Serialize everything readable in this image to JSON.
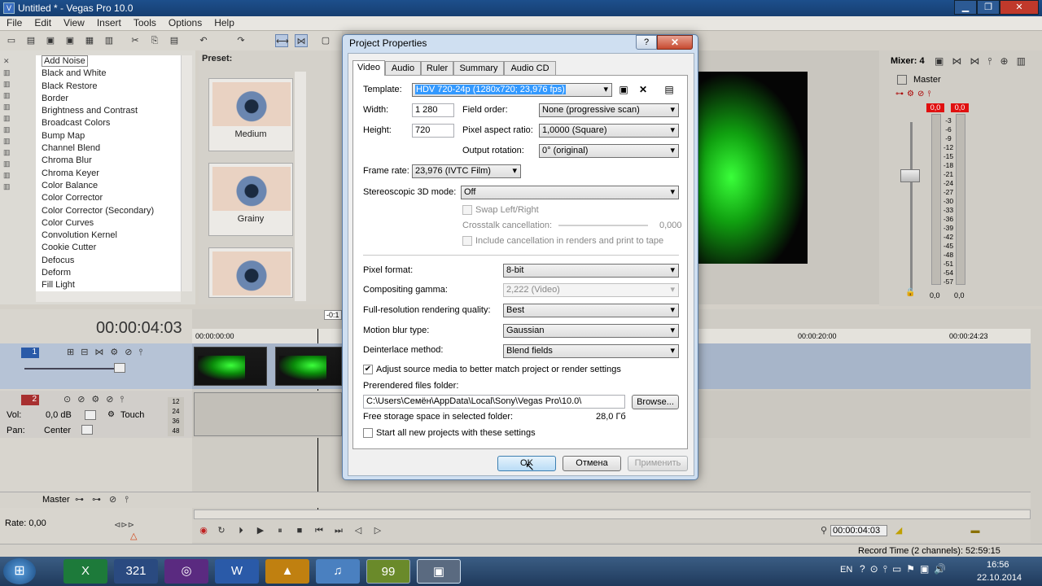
{
  "app": {
    "title": "Untitled * - Vegas Pro 10.0",
    "menu": [
      "File",
      "Edit",
      "View",
      "Insert",
      "Tools",
      "Options",
      "Help"
    ]
  },
  "fx": {
    "preset_label": "Preset:",
    "items": [
      "Add Noise",
      "Black and White",
      "Black Restore",
      "Border",
      "Brightness and Contrast",
      "Broadcast Colors",
      "Bump Map",
      "Channel Blend",
      "Chroma Blur",
      "Chroma Keyer",
      "Color Balance",
      "Color Corrector",
      "Color Corrector (Secondary)",
      "Color Curves",
      "Convolution Kernel",
      "Cookie Cutter",
      "Defocus",
      "Deform",
      "Fill Light"
    ],
    "presets": [
      "Medium",
      "Grainy"
    ]
  },
  "mixer": {
    "title": "Mixer: 4",
    "master_label": "Master",
    "peak_left": "0,0",
    "peak_right": "0,0",
    "scale": [
      "3",
      "6",
      "9",
      "12",
      "15",
      "18",
      "21",
      "24",
      "27",
      "30",
      "33",
      "36",
      "39",
      "42",
      "45",
      "48",
      "51",
      "54",
      "57"
    ],
    "bottom_left": "0,0",
    "bottom_right": "0,0"
  },
  "timeline": {
    "time": "00:00:04:03",
    "ruler_start": "00:00:00:00",
    "ruler_t20": "00:00:20:00",
    "ruler_t24": "00:00:24:23",
    "track1_num": "1",
    "track2_num": "2",
    "vol_label": "Vol:",
    "vol_value": "0,0 dB",
    "touch_label": "Touch",
    "pan_label": "Pan:",
    "pan_value": "Center",
    "master_label": "Master",
    "rate_label": "Rate: 0,00",
    "transport_time": "00:00:04:03",
    "marker": "-0:1",
    "level_labels": [
      "12",
      "24",
      "36",
      "48"
    ]
  },
  "status": {
    "record_time": "Record Time (2 channels): 52:59:15"
  },
  "taskbar": {
    "lang": "EN",
    "time": "16:56",
    "date": "22.10.2014",
    "apps": [
      "excel-icon",
      "calendar-321-icon",
      "disc-icon",
      "word-icon",
      "avast-icon",
      "audio-icon",
      "sticky-99-icon",
      "vegas-icon"
    ],
    "badge_99": "99",
    "badge_321": "321"
  },
  "dialog": {
    "title": "Project Properties",
    "help": "?",
    "close": "✕",
    "tabs": [
      "Video",
      "Audio",
      "Ruler",
      "Summary",
      "Audio CD"
    ],
    "template_label": "Template:",
    "template_value": "HDV 720-24p (1280x720; 23,976 fps)",
    "width_label": "Width:",
    "width_value": "1 280",
    "height_label": "Height:",
    "height_value": "720",
    "field_order_label": "Field order:",
    "field_order_value": "None (progressive scan)",
    "par_label": "Pixel aspect ratio:",
    "par_value": "1,0000 (Square)",
    "rotation_label": "Output rotation:",
    "rotation_value": "0° (original)",
    "framerate_label": "Frame rate:",
    "framerate_value": "23,976 (IVTC Film)",
    "stereo_label": "Stereoscopic 3D mode:",
    "stereo_value": "Off",
    "swap_label": "Swap Left/Right",
    "crosstalk_label": "Crosstalk cancellation:",
    "crosstalk_value": "0,000",
    "include_label": "Include cancellation in renders and print to tape",
    "pixel_format_label": "Pixel format:",
    "pixel_format_value": "8-bit",
    "gamma_label": "Compositing gamma:",
    "gamma_value": "2,222 (Video)",
    "quality_label": "Full-resolution rendering quality:",
    "quality_value": "Best",
    "blur_label": "Motion blur type:",
    "blur_value": "Gaussian",
    "deinterlace_label": "Deinterlace method:",
    "deinterlace_value": "Blend fields",
    "adjust_label": "Adjust source media to better match project or render settings",
    "prerender_label": "Prerendered files folder:",
    "prerender_value": "C:\\Users\\Семён\\AppData\\Local\\Sony\\Vegas Pro\\10.0\\",
    "browse": "Browse...",
    "free_label": "Free storage space in selected folder:",
    "free_value": "28,0 Гб",
    "start_all_label": "Start all new projects with these settings",
    "ok": "OK",
    "cancel": "Отмена",
    "apply": "Применить"
  }
}
